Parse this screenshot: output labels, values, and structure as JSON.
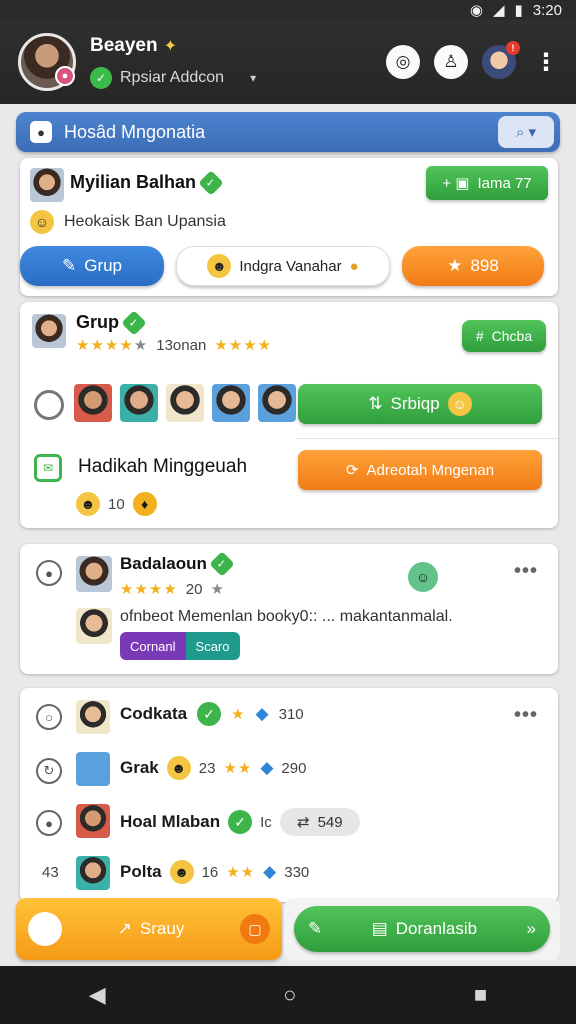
{
  "status": {
    "time": "3:20"
  },
  "header": {
    "user_name": "Beayen",
    "sub_label": "Rpsiar Addcon",
    "icons": [
      "record-icon",
      "person-icon",
      "profile-avatar",
      "more-icon"
    ]
  },
  "search": {
    "title": "Hosâd Mngonatia"
  },
  "card1": {
    "name": "Myilian Balhan",
    "subtitle": "Heokaisk Ban Upansia",
    "green_btn": "Iama 77",
    "tab_blue": "Grup",
    "tab_white": "Indgra Vanahar",
    "tab_orange": "898"
  },
  "card2": {
    "name": "Grup",
    "rating_text": "13onan",
    "chat_btn": "Chcba",
    "action_green": "Srbiqp",
    "title2": "Hadikah Minggeuah",
    "action_orange": "Adreotah Mngenan",
    "count": "10"
  },
  "card3": {
    "name": "Badalaoun",
    "rating_text": "20",
    "message": "ofnbeot Memenlan booky0:: ... makantanmalal.",
    "tag1": "Cornanl",
    "tag2": "Scaro"
  },
  "list": [
    {
      "name": "Codkata",
      "score": "310"
    },
    {
      "name": "Grak",
      "count": "23",
      "score": "290"
    },
    {
      "name": "Hoal Mlaban",
      "count": "Ic",
      "score": "549"
    },
    {
      "name": "Polta",
      "count": "16",
      "score": "330",
      "left": "43"
    }
  ],
  "bottom": {
    "left_btn": "Srauy",
    "right_btn": "Doranlasib"
  },
  "colors": {
    "accent_blue": "#3c6db7",
    "green": "#3db54a",
    "orange": "#f27c16"
  }
}
